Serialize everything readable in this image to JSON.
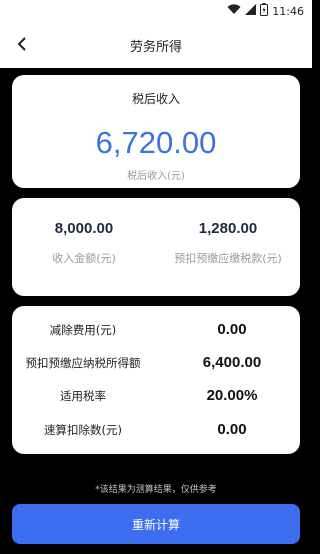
{
  "status": {
    "time": "11:46"
  },
  "header": {
    "title": "劳务所得"
  },
  "after_tax_card": {
    "label": "税后收入",
    "amount": "6,720.00",
    "sublabel": "税后收入(元)"
  },
  "summary_card": {
    "income_value": "8,000.00",
    "income_label": "收入金额(元)",
    "tax_value": "1,280.00",
    "tax_label": "预扣预缴应缴税款(元)"
  },
  "details": [
    {
      "label": "减除费用(元)",
      "value": "0.00"
    },
    {
      "label": "预扣预缴应纳税所得额",
      "value": "6,400.00"
    },
    {
      "label": "适用税率",
      "value": "20.00%"
    },
    {
      "label": "速算扣除数(元)",
      "value": "0.00"
    }
  ],
  "footnote": "*该结果为测算结果，仅供参考",
  "recalc_button": "重新计算",
  "colors": {
    "accent": "#3d6ef0",
    "amount": "#3b73e0"
  },
  "icons": [
    "wifi-icon",
    "signal-icon",
    "battery-icon",
    "back-arrow-icon"
  ]
}
